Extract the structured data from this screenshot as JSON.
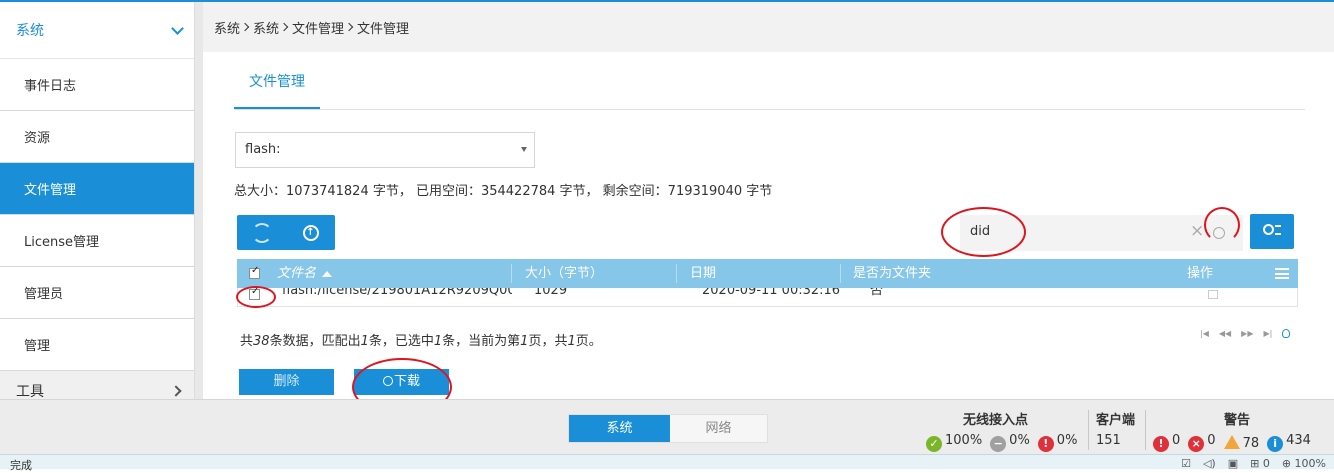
{
  "sidebar": {
    "section_title": "系统",
    "items": [
      {
        "label": "事件日志"
      },
      {
        "label": "资源"
      },
      {
        "label": "文件管理"
      },
      {
        "label": "License管理"
      },
      {
        "label": "管理员"
      },
      {
        "label": "管理"
      }
    ],
    "tools_label": "工具",
    "active_index": 2
  },
  "breadcrumb": [
    "系统",
    "系统",
    "文件管理",
    "文件管理"
  ],
  "tab": {
    "label": "文件管理"
  },
  "storage_select": {
    "value": "flash:"
  },
  "storage_info": "总大小：1073741824 字节， 已用空间：354422784 字节， 剩余空间：719319040 字节",
  "search": {
    "value": "did"
  },
  "table": {
    "columns": [
      "文件名",
      "大小（字节）",
      "日期",
      "是否为文件夹",
      "操作"
    ],
    "rows": [
      {
        "name": "flash:/license/219801A12R9209Q00...",
        "size": "1029",
        "date": "2020-09-11 00:32:16",
        "is_folder": "否"
      }
    ]
  },
  "summary": {
    "p1": "共",
    "total": "38",
    "p2": "条数据，匹配出",
    "matched": "1",
    "p3": "条，已选中",
    "selected": "1",
    "p4": "条，当前为第",
    "page": "1",
    "p5": "页，共",
    "pages": "1",
    "p6": "页。"
  },
  "actions": {
    "delete": "删除",
    "download": "下载"
  },
  "bottom": {
    "tabs": [
      "系统",
      "网络"
    ],
    "ap": {
      "title": "无线接入点",
      "online": "100%",
      "offline": "0%",
      "fault": "0%"
    },
    "clients": {
      "title": "客户端",
      "count": "151"
    },
    "alarms": {
      "title": "警告",
      "critical": "0",
      "major": "0",
      "minor": "78",
      "info": "434"
    }
  },
  "statusbar": {
    "left": "完成",
    "zoom": "100%",
    "count": "0"
  },
  "colors": {
    "accent": "#1a8fd8",
    "header": "#86c6e8",
    "annotation": "#e0141e"
  }
}
